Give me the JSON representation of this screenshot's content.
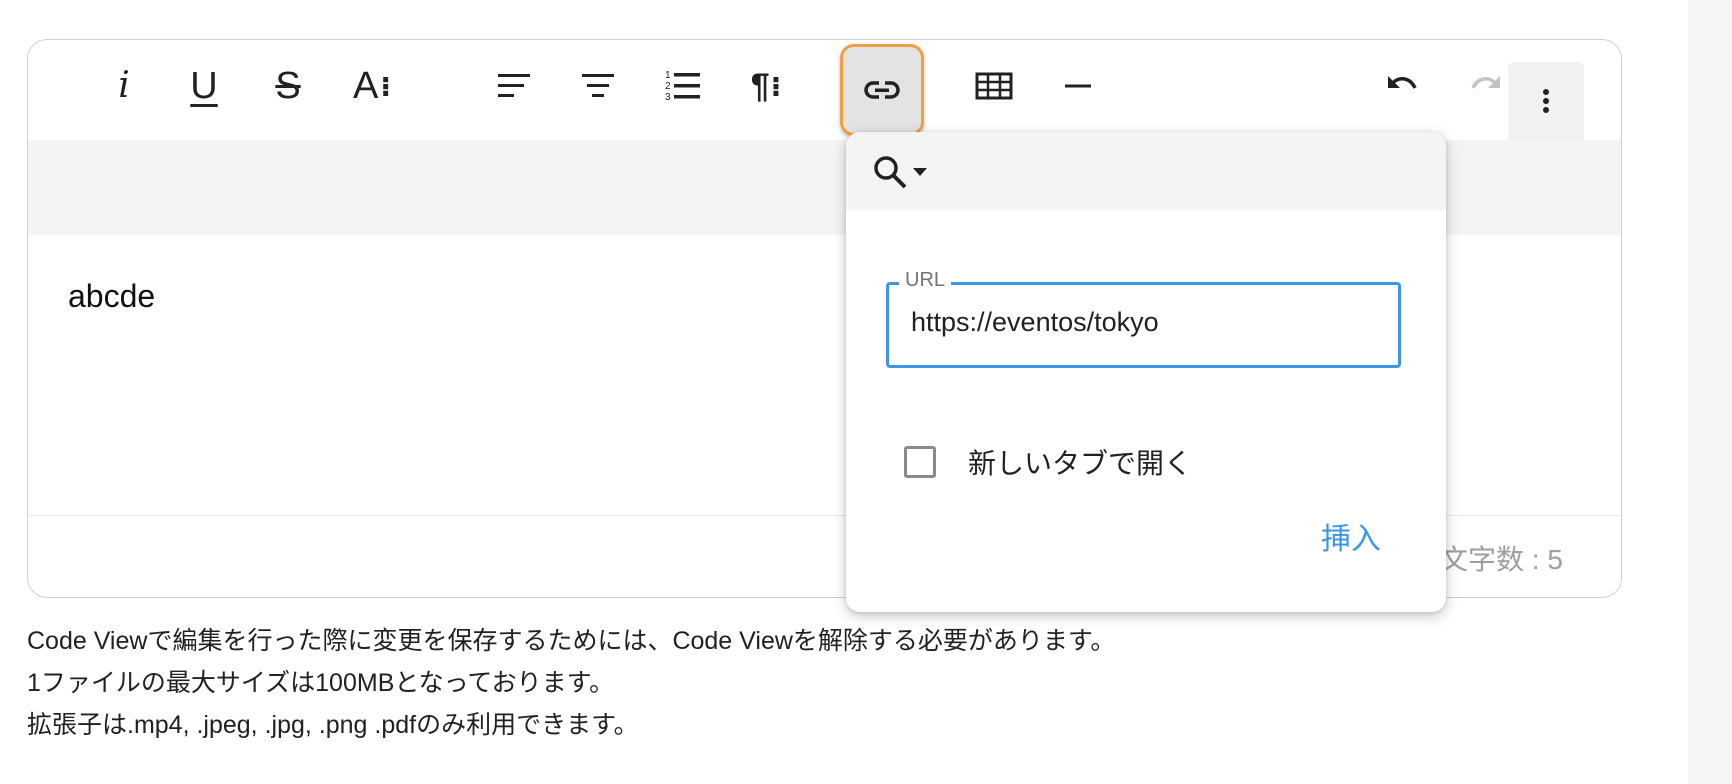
{
  "editor": {
    "content_text": "abcde",
    "char_count": "文字数 : 5"
  },
  "toolbar": {
    "italic": "i",
    "underline": "U",
    "strikethrough": "S",
    "font_size": "A",
    "paragraph": "¶",
    "icons": [
      "italic-icon",
      "underline-icon",
      "strikethrough-icon",
      "font-size-icon",
      "align-left-icon",
      "align-center-icon",
      "ordered-list-icon",
      "paragraph-icon",
      "link-icon",
      "table-icon",
      "horizontal-rule-icon",
      "undo-icon",
      "redo-icon",
      "more-vert-icon"
    ]
  },
  "link_dialog": {
    "url_label": "URL",
    "url_value": "https://eventos/tokyo",
    "new_tab_label": "新しいタブで開く",
    "new_tab_checked": false,
    "insert_label": "挿入"
  },
  "notes": [
    "Code Viewで編集を行った際に変更を保存するためには、Code Viewを解除する必要があります。",
    "1ファイルの最大サイズは100MBとなっております。",
    "拡張子は.mp4, .jpeg, .jpg, .png .pdfのみ利用できます。"
  ],
  "colors": {
    "accent": "#3c96e6",
    "active_outline": "#f0a040",
    "toolbar_bg": "#f4f4f4",
    "muted_text": "#9e9e9e"
  }
}
